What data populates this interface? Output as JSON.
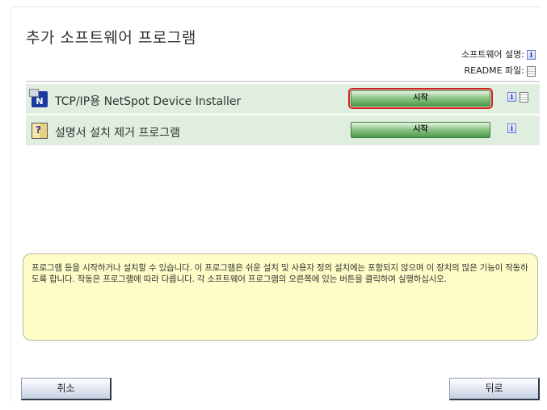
{
  "page": {
    "title": "추가 소프트웨어 프로그램"
  },
  "legend": {
    "description_label": "소프트웨어 설명:",
    "readme_label": "README 파일:"
  },
  "programs": [
    {
      "label": "TCP/IP용 NetSpot Device Installer",
      "start_label": "시작",
      "has_info": true,
      "has_readme": true,
      "focused": true
    },
    {
      "label": "설명서 설치 제거 프로그램",
      "start_label": "시작",
      "has_info": true,
      "has_readme": false,
      "focused": false
    }
  ],
  "description": "프로그램 등을 시작하거나 설치할 수 있습니다. 이 프로그램은 쉬운 설치 및 사용자 정의 설치에는 포함되지 않으며 이 장치의 많은 기능이 작동하도록 합니다. 작동은 프로그램에 따라 다릅니다. 각 소프트웨어 프로그램의 오른쪽에 있는 버튼을 클릭하여 실행하십시오.",
  "buttons": {
    "cancel": "취소",
    "back": "뒤로"
  },
  "icons": {
    "info": "info-icon",
    "readme": "readme-icon",
    "netspot": "netspot-installer-icon",
    "manual_uninstall": "manual-book-icon"
  },
  "colors": {
    "row_background": "#dfeede",
    "start_button": "#8fc889",
    "focus_outline": "#d21f1f",
    "description_background": "#fefdc7"
  }
}
